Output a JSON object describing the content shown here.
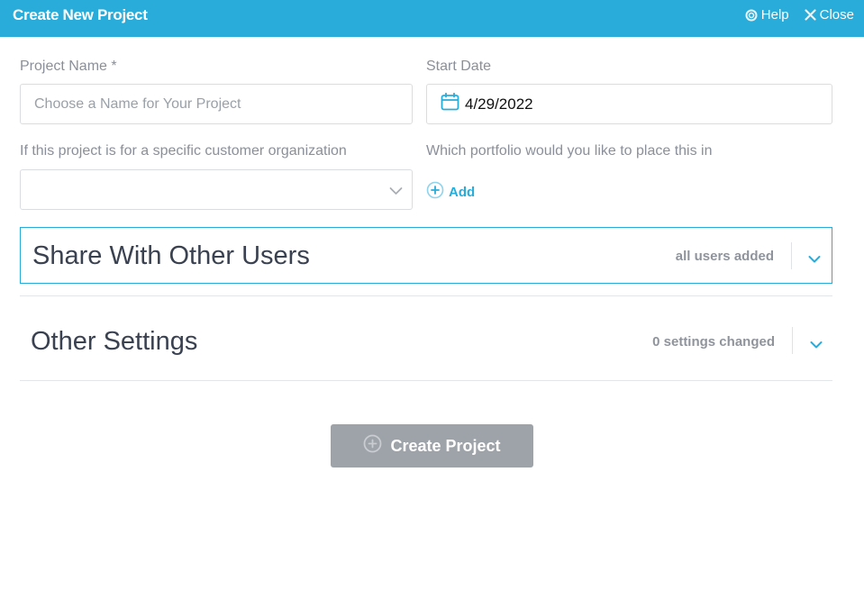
{
  "header": {
    "title": "Create New Project",
    "help_label": "Help",
    "close_label": "Close",
    "background": "#29acd9"
  },
  "form": {
    "project_name": {
      "label": "Project Name *",
      "placeholder": "Choose a Name for Your Project",
      "value": ""
    },
    "start_date": {
      "label": "Start Date",
      "value": "4/29/2022"
    },
    "customer_org": {
      "label": "If this project is for a specific customer organization",
      "selected": ""
    },
    "portfolio": {
      "label": "Which portfolio would you like to place this in",
      "add_label": "Add"
    }
  },
  "panels": {
    "share": {
      "title": "Share With Other Users",
      "status": "all users added"
    },
    "other": {
      "title": "Other Settings",
      "status": "0 settings changed"
    }
  },
  "actions": {
    "create_label": "Create Project"
  },
  "colors": {
    "accent": "#29acd9",
    "button_disabled": "#9ea3aa"
  }
}
